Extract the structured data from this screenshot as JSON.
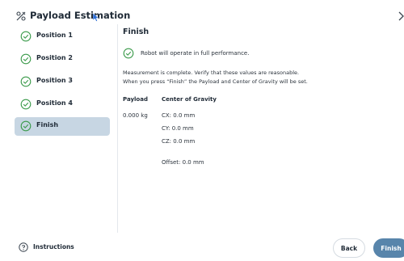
{
  "header": {
    "title": "Payload Estimation",
    "title_icon": "payload-scale-icon",
    "close_icon": "chevron-right-icon"
  },
  "sidebar": {
    "items": [
      {
        "label": "Position 1",
        "icon": "check-circle-icon",
        "active": false
      },
      {
        "label": "Position 2",
        "icon": "check-circle-icon",
        "active": false
      },
      {
        "label": "Position 3",
        "icon": "check-circle-icon",
        "active": false
      },
      {
        "label": "Position 4",
        "icon": "check-circle-icon",
        "active": false
      },
      {
        "label": "Finish",
        "icon": "check-circle-icon",
        "active": true
      }
    ]
  },
  "main": {
    "section_title": "Finish",
    "status": "Robot will operate in full performance.",
    "message_line1": "Measurement is complete. Verify that these values are reasonable.",
    "message_line2": "When you press “Finish” the Payload and Center of Gravity will be set.",
    "payload_header": "Payload",
    "cog_header": "Center of Gravity",
    "payload_value": "0.000 kg",
    "cx": "CX: 0.0 mm",
    "cy": "CY: 0.0 mm",
    "cz": "CZ: 0.0 mm",
    "offset": "Offset: 0.0 mm"
  },
  "footer": {
    "instructions_label": "Instructions",
    "instructions_icon": "help-circle-icon",
    "back_label": "Back",
    "finish_label": "Finish"
  },
  "colors": {
    "accent": "#5885ab",
    "active_item_bg": "#c7d6e3",
    "success_green": "#3a9a4a"
  }
}
